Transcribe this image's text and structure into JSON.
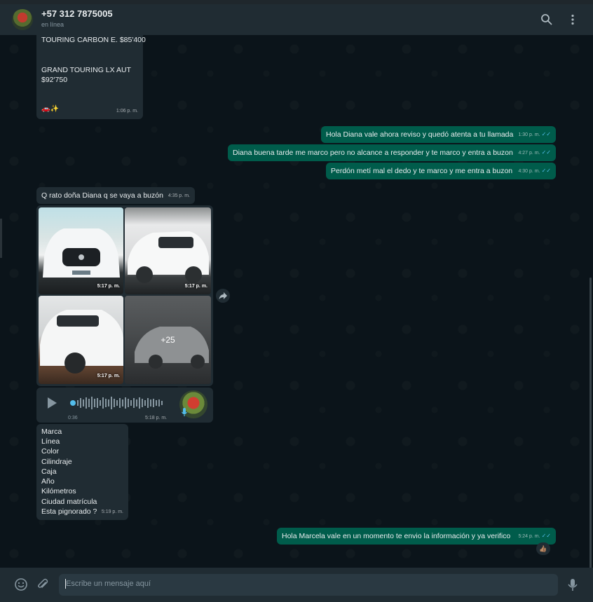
{
  "header": {
    "contact_name": "+57 312 7875005",
    "status": "en línea",
    "icons": [
      "search-icon",
      "menu-icon"
    ]
  },
  "messages": {
    "m1": {
      "lines": [
        "TOURING CARBON E. $85'400",
        "GRAND TOURING LX AUT",
        "$92'750",
        "🚗✨"
      ],
      "time": "1:06 p. m."
    },
    "m2": {
      "text": "Hola Diana vale ahora reviso y quedó atenta a tu llamada",
      "time": "1:30 p. m."
    },
    "m3": {
      "text": "Diana buena tarde me marco pero no alcance a responder y te marco y entra a buzon",
      "time": "4:27 p. m."
    },
    "m4": {
      "text": "Perdón metí mal el dedo y te marco y me entra a buzon",
      "time": "4:30 p. m."
    },
    "m5": {
      "text": "Q rato doña Diana q se vaya a buzón",
      "time": "4:35 p. m."
    },
    "gallery": {
      "photos": [
        {
          "time": "5:17 p. m."
        },
        {
          "time": "5:17 p. m."
        },
        {
          "time": "5:17 p. m."
        }
      ],
      "more_count": "+25",
      "forward_icon": "forward-icon"
    },
    "voice": {
      "duration": "0:36",
      "time": "5:18 p. m."
    },
    "list": {
      "items": [
        "Marca",
        "Línea",
        "Color",
        "Cilindraje",
        "Caja",
        "Año",
        "Kilómetros",
        "Ciudad matrícula",
        "Esta pignorado ?"
      ],
      "time": "5:19 p. m."
    },
    "m6": {
      "text": "Hola Marcela vale en un momento te envio la información y ya verifico",
      "time": "5:24 p. m.",
      "reaction": "👍🏽"
    }
  },
  "footer": {
    "placeholder": "Escribe un mensaje aquí",
    "icons": [
      "emoji-icon",
      "attach-icon",
      "microphone-icon"
    ]
  },
  "colors": {
    "background": "#0b141a",
    "header": "#202c33",
    "incoming": "#202c33",
    "outgoing": "#005c4b",
    "read_ticks": "#53bdeb"
  }
}
